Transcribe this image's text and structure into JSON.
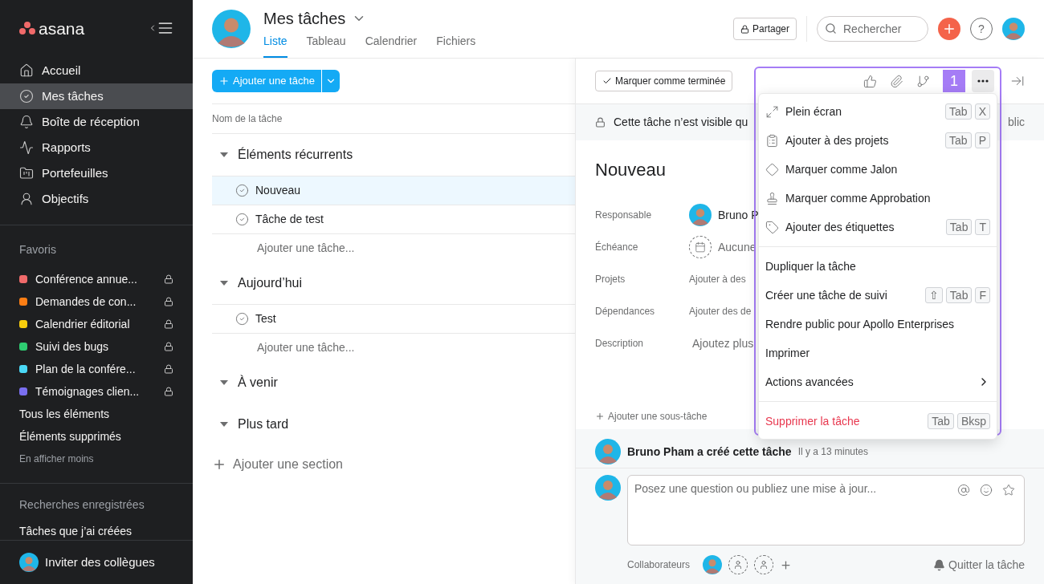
{
  "sidebar": {
    "logo": "asana",
    "nav": [
      {
        "label": "Accueil",
        "selected": false
      },
      {
        "label": "Mes tâches",
        "selected": true
      },
      {
        "label": "Boîte de réception",
        "selected": false
      },
      {
        "label": "Rapports",
        "selected": false
      },
      {
        "label": "Portefeuilles",
        "selected": false
      },
      {
        "label": "Objectifs",
        "selected": false
      }
    ],
    "favorites_title": "Favoris",
    "favorites": [
      {
        "label": "Conférence annue...",
        "color": "#f06a6a"
      },
      {
        "label": "Demandes de con...",
        "color": "#fd7e14"
      },
      {
        "label": "Calendrier éditorial",
        "color": "#f8cd0c"
      },
      {
        "label": "Suivi des bugs",
        "color": "#2ecc71"
      },
      {
        "label": "Plan de la confére...",
        "color": "#4ad8f6"
      },
      {
        "label": "Témoignages clien...",
        "color": "#7a6ff0"
      }
    ],
    "links": [
      "Tous les éléments",
      "Éléments supprimés"
    ],
    "show_less": "En afficher moins",
    "saved_title": "Recherches enregistrées",
    "saved": [
      "Tâches que j’ai créées"
    ],
    "invite": "Inviter des collègues"
  },
  "header": {
    "title": "Mes tâches",
    "tabs": [
      {
        "label": "Liste",
        "selected": true
      },
      {
        "label": "Tableau",
        "selected": false
      },
      {
        "label": "Calendrier",
        "selected": false
      },
      {
        "label": "Fichiers",
        "selected": false
      }
    ],
    "share": "Partager",
    "search_placeholder": "Rechercher",
    "help": "?"
  },
  "list": {
    "add_button": "Ajouter une tâche",
    "column": "Nom de la tâche",
    "sections": [
      {
        "title": "Éléments récurrents",
        "tasks": [
          {
            "name": "Nouveau",
            "selected": true
          },
          {
            "name": "Tâche de test",
            "selected": false
          }
        ],
        "add_task": "Ajouter une tâche..."
      },
      {
        "title": "Aujourd’hui",
        "tasks": [
          {
            "name": "Test",
            "selected": false
          }
        ],
        "add_task": "Ajouter une tâche..."
      },
      {
        "title": "À venir"
      },
      {
        "title": "Plus tard"
      }
    ],
    "add_section": "Ajouter une section"
  },
  "detail": {
    "complete_button": "Marquer comme terminée",
    "badge": "1",
    "banner_left": "Cette tâche n’est visible qu",
    "banner_right": "blic",
    "title": "Nouveau",
    "fields": [
      {
        "label": "Responsable",
        "value": "Bruno P",
        "kind": "person"
      },
      {
        "label": "Échéance",
        "value": "Aucune",
        "kind": "date"
      },
      {
        "label": "Projets",
        "value": "Ajouter à des",
        "kind": "link"
      },
      {
        "label": "Dépendances",
        "value": "Ajouter des de",
        "kind": "link"
      },
      {
        "label": "Description",
        "value": "Ajoutez plus",
        "kind": "text"
      }
    ],
    "add_subtask": "Ajouter une sous-tâche",
    "activity": {
      "text": "Bruno Pham a créé cette tâche",
      "time": "Il y a 13 minutes"
    },
    "comment_placeholder": "Posez une question ou publiez une mise à jour...",
    "collaborators": "Collaborateurs",
    "leave": "Quitter la tâche"
  },
  "menu": {
    "groups": [
      [
        {
          "label": "Plein écran",
          "kind": "item",
          "shortcut": [
            "Tab",
            "X"
          ]
        },
        {
          "label": "Ajouter à des projets",
          "kind": "item",
          "shortcut": [
            "Tab",
            "P"
          ]
        },
        {
          "label": "Marquer comme Jalon",
          "kind": "item"
        },
        {
          "label": "Marquer comme Approbation",
          "kind": "item"
        },
        {
          "label": "Ajouter des étiquettes",
          "kind": "item",
          "shortcut": [
            "Tab",
            "T"
          ]
        }
      ],
      [
        {
          "label": "Dupliquer la tâche",
          "kind": "plain"
        },
        {
          "label": "Créer une tâche de suivi",
          "kind": "plain",
          "shortcut": [
            "⇧",
            "Tab",
            "F"
          ]
        },
        {
          "label": "Rendre public pour Apollo Enterprises",
          "kind": "plain"
        },
        {
          "label": "Imprimer",
          "kind": "plain"
        },
        {
          "label": "Actions avancées",
          "kind": "submenu"
        }
      ],
      [
        {
          "label": "Supprimer la tâche",
          "kind": "danger",
          "shortcut": [
            "Tab",
            "Bksp"
          ]
        }
      ]
    ]
  }
}
